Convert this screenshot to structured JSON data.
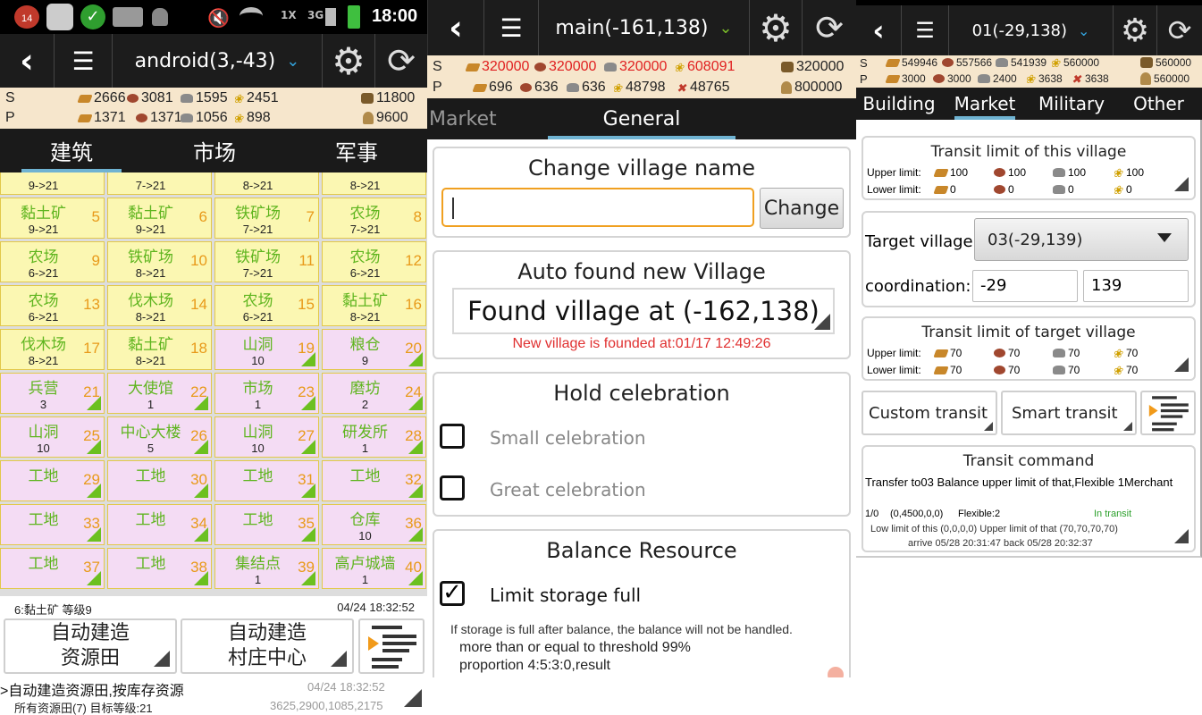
{
  "panel1": {
    "status": {
      "notif_count": "14",
      "time": "18:00",
      "net_left": "3G",
      "net_right": "1X"
    },
    "header": {
      "title": "android(3,-43)"
    },
    "resources": {
      "s_label": "S",
      "p_label": "P",
      "s": {
        "wood": "2666",
        "clay": "3081",
        "iron": "1595",
        "crop": "2451",
        "warehouse": "11800"
      },
      "p": {
        "wood": "1371",
        "clay": "1371",
        "iron": "1056",
        "crop": "898",
        "granary": "9600"
      }
    },
    "tabs": [
      "建筑",
      "市场",
      "军事"
    ],
    "grid": [
      {
        "name": "",
        "num": "",
        "level": "9->21",
        "type": "res"
      },
      {
        "name": "",
        "num": "",
        "level": "7->21",
        "type": "res"
      },
      {
        "name": "",
        "num": "",
        "level": "8->21",
        "type": "res"
      },
      {
        "name": "",
        "num": "",
        "level": "8->21",
        "type": "res"
      },
      {
        "name": "黏土矿",
        "num": "5",
        "level": "9->21",
        "type": "res"
      },
      {
        "name": "黏土矿",
        "num": "6",
        "level": "9->21",
        "type": "res"
      },
      {
        "name": "铁矿场",
        "num": "7",
        "level": "7->21",
        "type": "res"
      },
      {
        "name": "农场",
        "num": "8",
        "level": "7->21",
        "type": "res"
      },
      {
        "name": "农场",
        "num": "9",
        "level": "6->21",
        "type": "res"
      },
      {
        "name": "铁矿场",
        "num": "10",
        "level": "8->21",
        "type": "res"
      },
      {
        "name": "铁矿场",
        "num": "11",
        "level": "7->21",
        "type": "res"
      },
      {
        "name": "农场",
        "num": "12",
        "level": "6->21",
        "type": "res"
      },
      {
        "name": "农场",
        "num": "13",
        "level": "6->21",
        "type": "res"
      },
      {
        "name": "伐木场",
        "num": "14",
        "level": "8->21",
        "type": "res"
      },
      {
        "name": "农场",
        "num": "15",
        "level": "6->21",
        "type": "res"
      },
      {
        "name": "黏土矿",
        "num": "16",
        "level": "8->21",
        "type": "res"
      },
      {
        "name": "伐木场",
        "num": "17",
        "level": "8->21",
        "type": "res"
      },
      {
        "name": "黏土矿",
        "num": "18",
        "level": "8->21",
        "type": "res"
      },
      {
        "name": "山洞",
        "num": "19",
        "level": "10",
        "type": "bld"
      },
      {
        "name": "粮仓",
        "num": "20",
        "level": "9",
        "type": "bld"
      },
      {
        "name": "兵营",
        "num": "21",
        "level": "3",
        "type": "bld"
      },
      {
        "name": "大使馆",
        "num": "22",
        "level": "1",
        "type": "bld"
      },
      {
        "name": "市场",
        "num": "23",
        "level": "1",
        "type": "bld"
      },
      {
        "name": "磨坊",
        "num": "24",
        "level": "2",
        "type": "bld"
      },
      {
        "name": "山洞",
        "num": "25",
        "level": "10",
        "type": "bld"
      },
      {
        "name": "中心大楼",
        "num": "26",
        "level": "5",
        "type": "bld"
      },
      {
        "name": "山洞",
        "num": "27",
        "level": "10",
        "type": "bld"
      },
      {
        "name": "研发所",
        "num": "28",
        "level": "1",
        "type": "bld"
      },
      {
        "name": "工地",
        "num": "29",
        "level": "",
        "type": "bld"
      },
      {
        "name": "工地",
        "num": "30",
        "level": "",
        "type": "bld"
      },
      {
        "name": "工地",
        "num": "31",
        "level": "",
        "type": "bld"
      },
      {
        "name": "工地",
        "num": "32",
        "level": "",
        "type": "bld"
      },
      {
        "name": "工地",
        "num": "33",
        "level": "",
        "type": "bld"
      },
      {
        "name": "工地",
        "num": "34",
        "level": "",
        "type": "bld"
      },
      {
        "name": "工地",
        "num": "35",
        "level": "",
        "type": "bld"
      },
      {
        "name": "仓库",
        "num": "36",
        "level": "10",
        "type": "bld"
      },
      {
        "name": "工地",
        "num": "37",
        "level": "",
        "type": "bld"
      },
      {
        "name": "工地",
        "num": "38",
        "level": "",
        "type": "bld"
      },
      {
        "name": "集结点",
        "num": "39",
        "level": "1",
        "type": "bld"
      },
      {
        "name": "高卢城墙",
        "num": "40",
        "level": "1",
        "type": "bld"
      }
    ],
    "info_line": {
      "left": "6:黏土矿   等级9",
      "right": "04/24 18:32:52"
    },
    "btn_auto_res": "自动建造\n资源田",
    "btn_auto_center": "自动建造\n村庄中心",
    "log": {
      "line1": ">自动建造资源田,按库存资源",
      "line1_time": "04/24 18:32:52",
      "line2": "所有资源田(7)   目标等级:21",
      "line2_right": "3625,2900,1085,2175"
    }
  },
  "panel2": {
    "header": {
      "title": "main(-161,138)"
    },
    "resources": {
      "s_label": "S",
      "p_label": "P",
      "s": {
        "wood": "320000",
        "clay": "320000",
        "iron": "320000",
        "crop": "608091",
        "warehouse": "320000"
      },
      "p": {
        "wood": "696",
        "clay": "636",
        "iron": "636",
        "crop": "48798",
        "cons": "48765",
        "granary": "800000"
      }
    },
    "tabs": [
      "Market",
      "General"
    ],
    "change_name": {
      "title": "Change village name",
      "value": "",
      "button": "Change"
    },
    "auto_found": {
      "title": "Auto found new Village",
      "selected": "Found village at (-162,138)",
      "status": "New village is founded at:01/17 12:49:26"
    },
    "celebration": {
      "title": "Hold celebration",
      "small": "Small celebration",
      "great": "Great celebration"
    },
    "balance": {
      "title": "Balance Resource",
      "limit": "Limit storage full",
      "note": "If storage is full after balance, the balance will not be handled.",
      "threshold": "more than or equal to threshold 99%",
      "proportion": "proportion 4:5:3:0,result"
    }
  },
  "panel3": {
    "header": {
      "title": "01(-29,138)"
    },
    "resources": {
      "s_label": "S",
      "p_label": "P",
      "s": {
        "wood": "549946",
        "clay": "557566",
        "iron": "541939",
        "crop": "560000",
        "warehouse": "560000"
      },
      "p": {
        "wood": "3000",
        "clay": "3000",
        "iron": "2400",
        "crop": "3638",
        "cons": "3638",
        "granary": "560000"
      }
    },
    "tabs": [
      "Building",
      "Market",
      "Military",
      "Other"
    ],
    "limit_this": {
      "title": "Transit limit of this village",
      "upper_label": "Upper limit:",
      "lower_label": "Lower limit:",
      "upper": [
        "100",
        "100",
        "100",
        "100"
      ],
      "lower": [
        "0",
        "0",
        "0",
        "0"
      ]
    },
    "target": {
      "label": "Target village:",
      "selected": "03(-29,139)",
      "coord_label": "coordination:",
      "x": "-29",
      "y": "139"
    },
    "limit_target": {
      "title": "Transit limit of target village",
      "upper_label": "Upper limit:",
      "lower_label": "Lower limit:",
      "upper": [
        "70",
        "70",
        "70",
        "70"
      ],
      "lower": [
        "70",
        "70",
        "70",
        "70"
      ]
    },
    "custom_transit": "Custom transit",
    "smart_transit": "Smart transit",
    "command": {
      "title": "Transit command",
      "line1": "Transfer to03 Balance upper limit of that,Flexible 1Merchant",
      "stat_count": "1/0",
      "stat_res": "(0,4500,0,0)",
      "stat_flex": "Flexible:2",
      "stat_status": "In transit",
      "line3": "Low limit of this (0,0,0,0) Upper limit of that (70,70,70,70)",
      "line4": "arrive 05/28 20:31:47 back 05/28 20:32:37"
    }
  },
  "colors": {
    "accent_red": "#e02020",
    "label_green": "#5fb51f",
    "number_orange": "#e89a1a",
    "tab_indicator": "#6fb3d2"
  }
}
